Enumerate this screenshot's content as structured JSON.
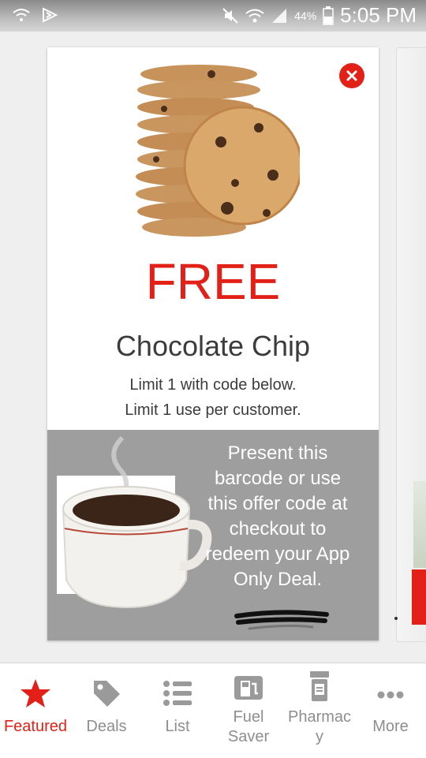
{
  "status_bar": {
    "battery": "44%",
    "time": "5:05 PM",
    "icons": [
      "wifi-question-icon",
      "app-notification-icon",
      "mute-icon",
      "wifi-icon",
      "signal-icon",
      "battery-icon"
    ]
  },
  "offer": {
    "headline": "FREE",
    "product": "Chocolate Chip",
    "limit_lines": [
      "Limit 1 with code below.",
      "Limit 1 use per customer."
    ],
    "redeem_lines": [
      "Present this",
      "barcode or use",
      "this offer code at",
      "checkout to",
      "redeem your App",
      "Only Deal."
    ],
    "close_icon": "close-icon"
  },
  "nav": {
    "items": [
      {
        "label_lines": [
          "Featured"
        ],
        "icon": "star-icon",
        "active": true
      },
      {
        "label_lines": [
          "Deals"
        ],
        "icon": "tag-icon",
        "active": false
      },
      {
        "label_lines": [
          "List"
        ],
        "icon": "list-icon",
        "active": false
      },
      {
        "label_lines": [
          "Fuel",
          "Saver"
        ],
        "icon": "fuel-pump-icon",
        "active": false
      },
      {
        "label_lines": [
          "Pharmac",
          "y"
        ],
        "icon": "pill-bottle-icon",
        "active": false
      },
      {
        "label_lines": [
          "More"
        ],
        "icon": "more-dots-icon",
        "active": false
      }
    ]
  },
  "colors": {
    "accent": "#e32017",
    "redeem_panel": "#9e9e9e",
    "nav_inactive": "#8e8e8e"
  }
}
